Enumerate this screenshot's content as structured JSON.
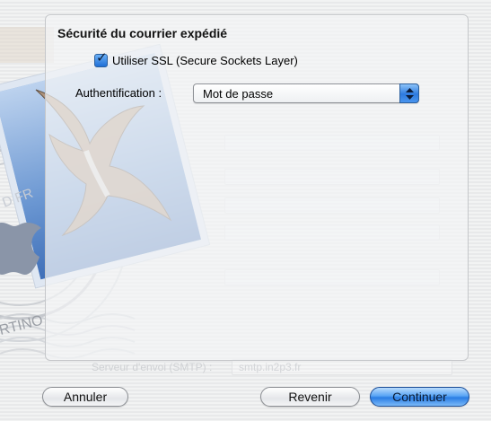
{
  "sheet": {
    "section_title": "Sécurité du courrier expédié",
    "ssl_checkbox": {
      "label": "Utiliser SSL (Secure Sockets Layer)",
      "checked": true
    },
    "authentication": {
      "label": "Authentification :",
      "selected": "Mot de passe"
    }
  },
  "buttons": {
    "cancel": "Annuler",
    "back": "Revenir",
    "continue": "Continuer"
  },
  "background_form": {
    "smtp_label": "Serveur d'envoi (SMTP) :",
    "smtp_value": "smtp.in2p3.fr"
  },
  "colors": {
    "accent": "#2a7de4",
    "checkbox": "#1f6fd6"
  },
  "icons": {
    "mail_stamp": "eagle-stamp-icon",
    "apple_logo": "apple-logo-icon",
    "checkbox": "checkmark-icon",
    "popup": "popup-arrows-icon"
  }
}
